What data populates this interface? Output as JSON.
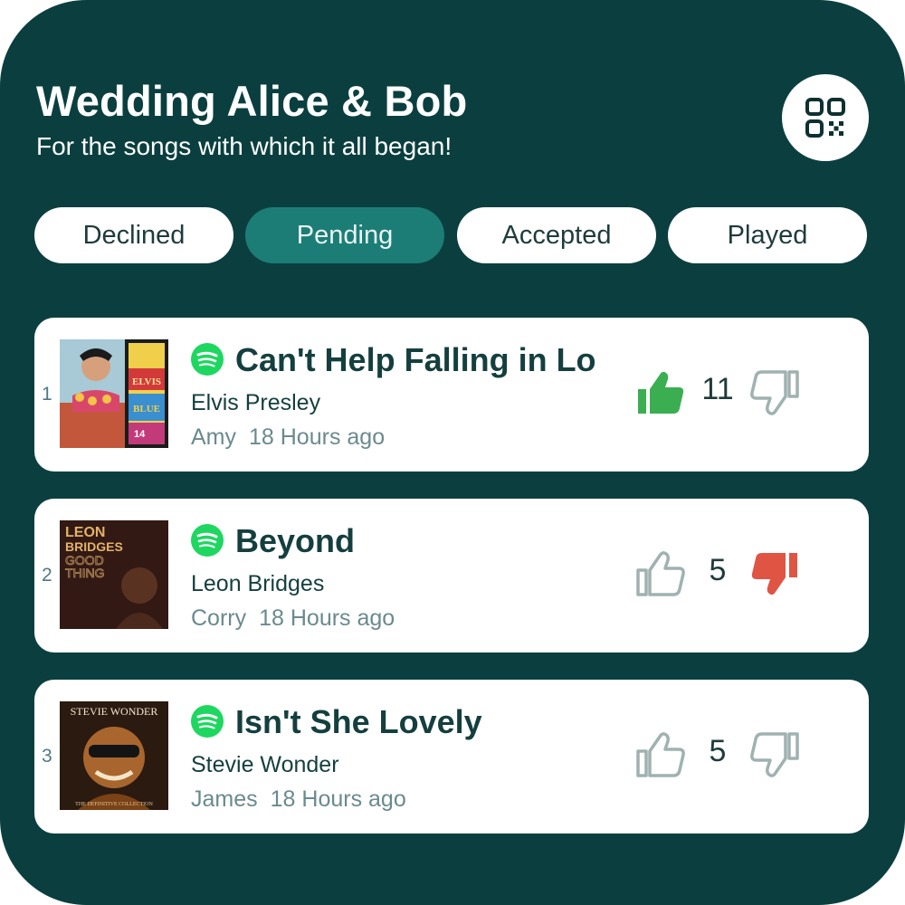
{
  "header": {
    "title": "Wedding Alice & Bob",
    "subtitle": "For the songs with which it all began!"
  },
  "tabs": [
    {
      "label": "Declined",
      "active": false
    },
    {
      "label": "Pending",
      "active": true
    },
    {
      "label": "Accepted",
      "active": false
    },
    {
      "label": "Played",
      "active": false
    }
  ],
  "songs": [
    {
      "rank": "1",
      "title": "Can't Help Falling in Lo",
      "artist": "Elvis Presley",
      "requester": "Amy",
      "time": "18 Hours ago",
      "votes": "11",
      "vote_state": "up",
      "cover_text": [
        "ELVIS",
        "BLUE",
        "14"
      ]
    },
    {
      "rank": "2",
      "title": "Beyond",
      "artist": "Leon Bridges",
      "requester": "Corry",
      "time": "18 Hours ago",
      "votes": "5",
      "vote_state": "down",
      "cover_text": [
        "LEON",
        "BRIDGES",
        "GOOD",
        "THING"
      ]
    },
    {
      "rank": "3",
      "title": "Isn't She Lovely",
      "artist": "Stevie Wonder",
      "requester": "James",
      "time": "18 Hours ago",
      "votes": "5",
      "vote_state": "none",
      "cover_text": [
        "STEVIE WONDER",
        "THE DEFINITIVE COLLECTION"
      ]
    }
  ],
  "colors": {
    "background": "#0b3f3f",
    "accent_tab": "#1c7d77",
    "upvote_active": "#3bae52",
    "downvote_active": "#e05444",
    "vote_inactive": "#9fb2b0",
    "spotify": "#1ed760"
  },
  "icons": {
    "qr": "qr-code-icon",
    "spotify": "spotify-icon",
    "upvote": "thumbs-up-icon",
    "downvote": "thumbs-down-icon"
  }
}
